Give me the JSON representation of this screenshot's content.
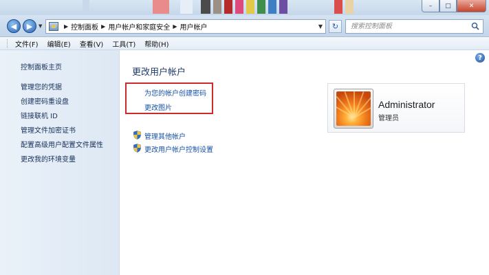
{
  "window": {
    "minimize_icon": "minimize-icon",
    "maximize_icon": "maximize-icon",
    "close_icon": "close-icon",
    "minimize_glyph": "–",
    "maximize_glyph": "□",
    "close_glyph": "✕"
  },
  "address_bar": {
    "back_glyph": "◀",
    "forward_glyph": "▶",
    "breadcrumbs": [
      "控制面板",
      "用户帐户和家庭安全",
      "用户帐户"
    ],
    "refresh_glyph": "↻"
  },
  "search": {
    "placeholder": "搜索控制面板"
  },
  "menu": [
    "文件(F)",
    "编辑(E)",
    "查看(V)",
    "工具(T)",
    "帮助(H)"
  ],
  "sidebar": {
    "items": [
      {
        "label": "控制面板主页"
      },
      {
        "label": "管理您的凭据"
      },
      {
        "label": "创建密码重设盘"
      },
      {
        "label": "链接联机 ID"
      },
      {
        "label": "管理文件加密证书"
      },
      {
        "label": "配置高级用户配置文件属性"
      },
      {
        "label": "更改我的环境变量"
      }
    ]
  },
  "main": {
    "title": "更改用户帐户",
    "tasks": [
      {
        "label": "为您的帐户创建密码"
      },
      {
        "label": "更改图片"
      }
    ],
    "admin_tasks": [
      {
        "label": "管理其他帐户",
        "icon": "uac-shield-icon"
      },
      {
        "label": "更改用户帐户控制设置",
        "icon": "uac-shield-icon"
      }
    ],
    "help_glyph": "?"
  },
  "account": {
    "name": "Administrator",
    "role": "管理员"
  },
  "colors": {
    "link": "#1650a6",
    "highlight_border": "#cc2a2a",
    "sidebar_bg": "#e3ecf6"
  }
}
